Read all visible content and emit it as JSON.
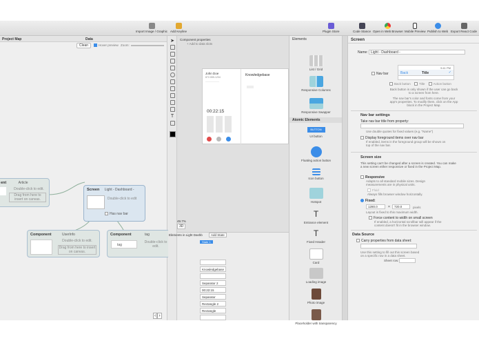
{
  "toolbar": {
    "items": [
      {
        "label": "Import Image / Graphic",
        "icon": "image-icon"
      },
      {
        "label": "Add Keyline",
        "icon": "keyline-icon"
      },
      {
        "label": "Plugin Store",
        "icon": "plugin-store-icon"
      },
      {
        "label": "Code Stance",
        "icon": "code-stance-icon"
      },
      {
        "label": "Open in Web Browser",
        "icon": "chrome-icon"
      },
      {
        "label": "Mobile Preview",
        "icon": "mobile-icon"
      },
      {
        "label": "Publish to Web",
        "icon": "publish-icon"
      },
      {
        "label": "Export React Code",
        "icon": "export-icon"
      }
    ]
  },
  "left_panel": {
    "title": "Project Map",
    "data_tab": "Data",
    "clean_button": "Clean",
    "hover_preview": "Hover preview",
    "zoom_label": "Zoom:"
  },
  "nodes": {
    "article": {
      "type": "ent",
      "name": "Article",
      "hint1": "Double-click to edit.",
      "hint2": "Drag from here to insert on canvas."
    },
    "screen": {
      "type": "Screen",
      "name": "Light - Dashboard -",
      "hint": "Double-click to edit",
      "navbar": "Has nav bar"
    },
    "userinfo": {
      "type": "Component",
      "name": "UserInfo",
      "hint1": "Double-click to edit.",
      "hint2": "Drag from here to insert on canvas."
    },
    "tag": {
      "type": "Component",
      "name": "tag",
      "hint": "Double-click to edit.",
      "chip": "tag"
    }
  },
  "canvas": {
    "component_properties": "Component properties",
    "add_data_slots": "+ Add to data slots",
    "user_name": "John Doe",
    "phone": "872-555-1234",
    "knowledgebase_title": "Knowledgebase",
    "timer": "00:22:15",
    "zoom": "49.7%",
    "view_mode": "3D"
  },
  "elements_tree": {
    "title": "Elements in",
    "screen_name": "Light Dashb",
    "add_state": "Add State",
    "state": "State 1",
    "rows": [
      "",
      "Knowledgebase",
      "",
      "Separator 2",
      "00:22:15",
      "Separator",
      "Rectangle 2",
      "Rectangle",
      "",
      "",
      ""
    ]
  },
  "elements_panel": {
    "title": "Elements",
    "atomic_title": "Atomic Elements",
    "button_label": "BUTTON",
    "items": [
      {
        "label": "List / Grid",
        "icon": "grid-icon"
      },
      {
        "label": "Responsive Columns",
        "icon": "columns-icon"
      },
      {
        "label": "Responsive Swapper",
        "icon": "swapper-icon"
      },
      {
        "label": "UI button",
        "icon": "button-icon"
      },
      {
        "label": "Floating action button",
        "icon": "fab-icon"
      },
      {
        "label": "Icon button",
        "icon": "icon-button-icon"
      },
      {
        "label": "Hotspot",
        "icon": "hotspot-icon"
      },
      {
        "label": "Entrance element",
        "icon": "text-icon"
      },
      {
        "label": "Fixed Header",
        "icon": "header-icon"
      },
      {
        "label": "Card",
        "icon": "card-icon"
      },
      {
        "label": "Loading image",
        "icon": "loading-image-icon"
      },
      {
        "label": "Photo image",
        "icon": "photo-icon"
      },
      {
        "label": "Placeholder with transparency",
        "icon": "placeholder-icon"
      }
    ]
  },
  "inspector": {
    "title": "Screen",
    "name_label": "Name:",
    "name_value": "Light - Dashboard -",
    "nav_bar_label": "Nav bar",
    "nav_back": "Back",
    "nav_title": "Title",
    "nav_time": "9:41 PM",
    "nav_opts": [
      "Back button",
      "Title",
      "Action button"
    ],
    "nav_help1": "Back button is only shown if the user can go back to a screen from here.",
    "nav_help2": "The nav bar's color and fonts come from your app's properties. To modify them, click on the App block in the Project Map.",
    "nav_settings_title": "Nav bar settings",
    "take_title_label": "Take nav bar title from property:",
    "double_curly_hint": "Use double quotes for fixed values (e.g. \"Name\")",
    "display_fg_label": "Display foreground items over nav bar",
    "display_fg_help": "If enabled, items in the foreground group will be shown on top of the nav bar.",
    "screen_size_title": "Screen size",
    "screen_size_help": "This setting can't be changed after a screen is created. You can make a new screen either responsive or fixed in the Project Map.",
    "responsive_label": "Responsive",
    "responsive_help": "Adapts to all standard mobile sizes. Design measurements are in physical units.",
    "fluid_label": "Fluid",
    "fluid_help": "Always fills browser window horizontally.",
    "fixed_label": "Fixed:",
    "width_value": "1280.0",
    "height_value": "720.0",
    "px_label": "pixels",
    "fixed_help": "Layout is fixed to this maximum width.",
    "force_label": "Force content to width on small screen",
    "force_help": "If enabled, a horizontal scrollbar will appear if the content doesn't fit in the browser window.",
    "data_source_title": "Data Source",
    "carry_label": "Carry properties from data sheet:",
    "carry_help": "Use this setting to fill out this screen based on a specific row in a data sheet.",
    "sheet_row_label": "Sheet row:"
  },
  "colors": {
    "accent": "#3b8de8",
    "screen_node": "#dbe6f0",
    "component_node": "#dfe6e3"
  }
}
